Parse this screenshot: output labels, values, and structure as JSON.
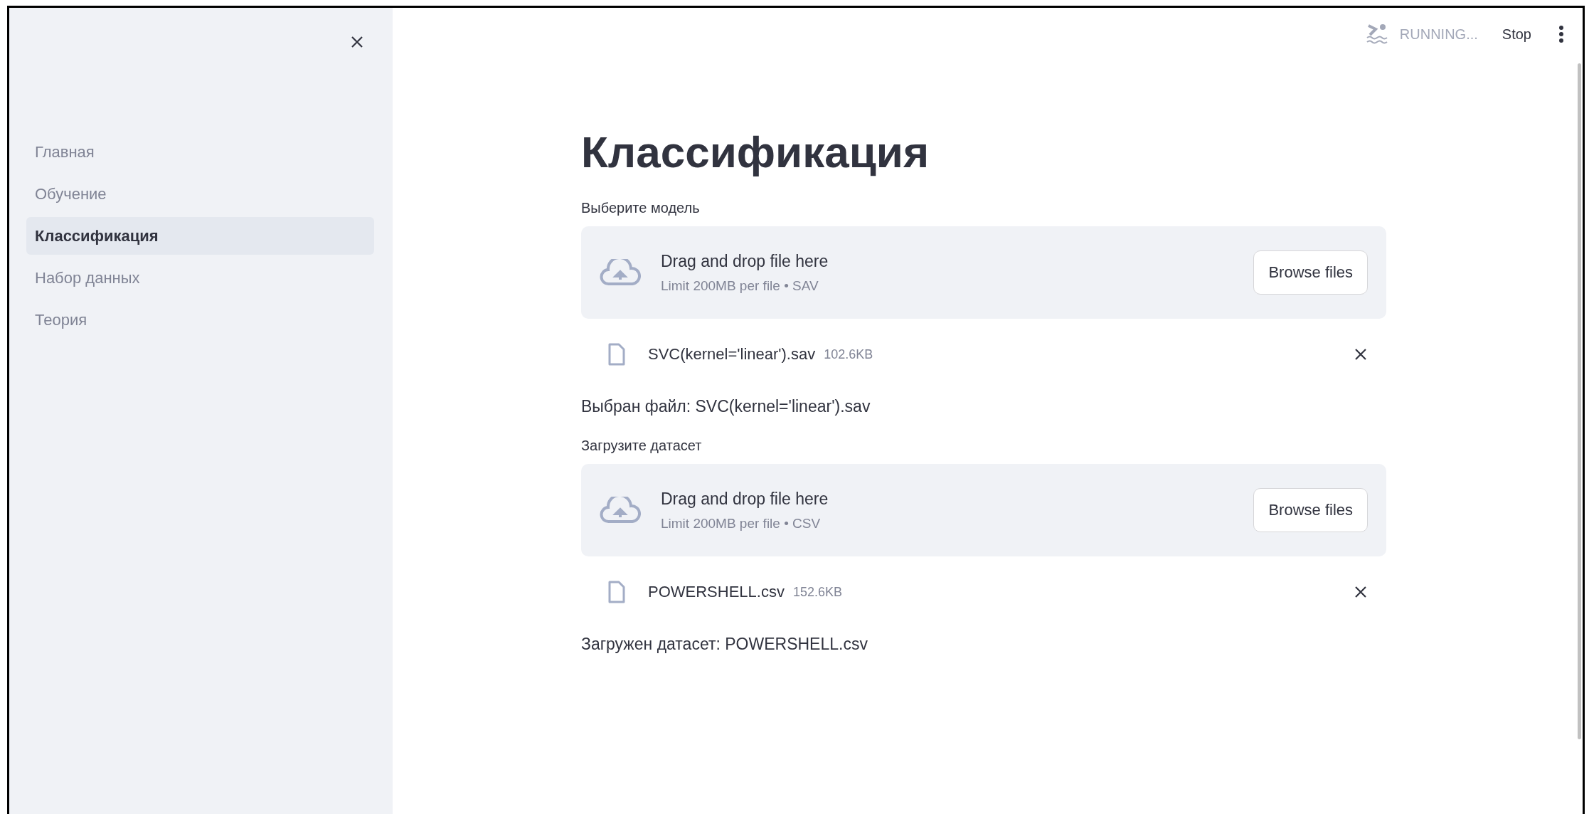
{
  "sidebar": {
    "items": [
      {
        "label": "Главная",
        "selected": false
      },
      {
        "label": "Обучение",
        "selected": false
      },
      {
        "label": "Классификация",
        "selected": true
      },
      {
        "label": "Набор данных",
        "selected": false
      },
      {
        "label": "Теория",
        "selected": false
      }
    ]
  },
  "header": {
    "status": "RUNNING...",
    "stop_button": "Stop"
  },
  "title": "Классификация",
  "uploaders": [
    {
      "label": "Выберите модель",
      "dropzone_text": "Drag and drop file here",
      "limit_text": "Limit 200MB per file • SAV",
      "browse_button": "Browse files",
      "file": {
        "name": "SVC(kernel='linear').sav",
        "size": "102.6KB"
      },
      "result": "Выбран файл: SVC(kernel='linear').sav"
    },
    {
      "label": "Загрузите датасет",
      "dropzone_text": "Drag and drop file here",
      "limit_text": "Limit 200MB per file • CSV",
      "browse_button": "Browse files",
      "file": {
        "name": "POWERSHELL.csv",
        "size": "152.6KB"
      },
      "result": "Загружен датасет: POWERSHELL.csv"
    }
  ]
}
